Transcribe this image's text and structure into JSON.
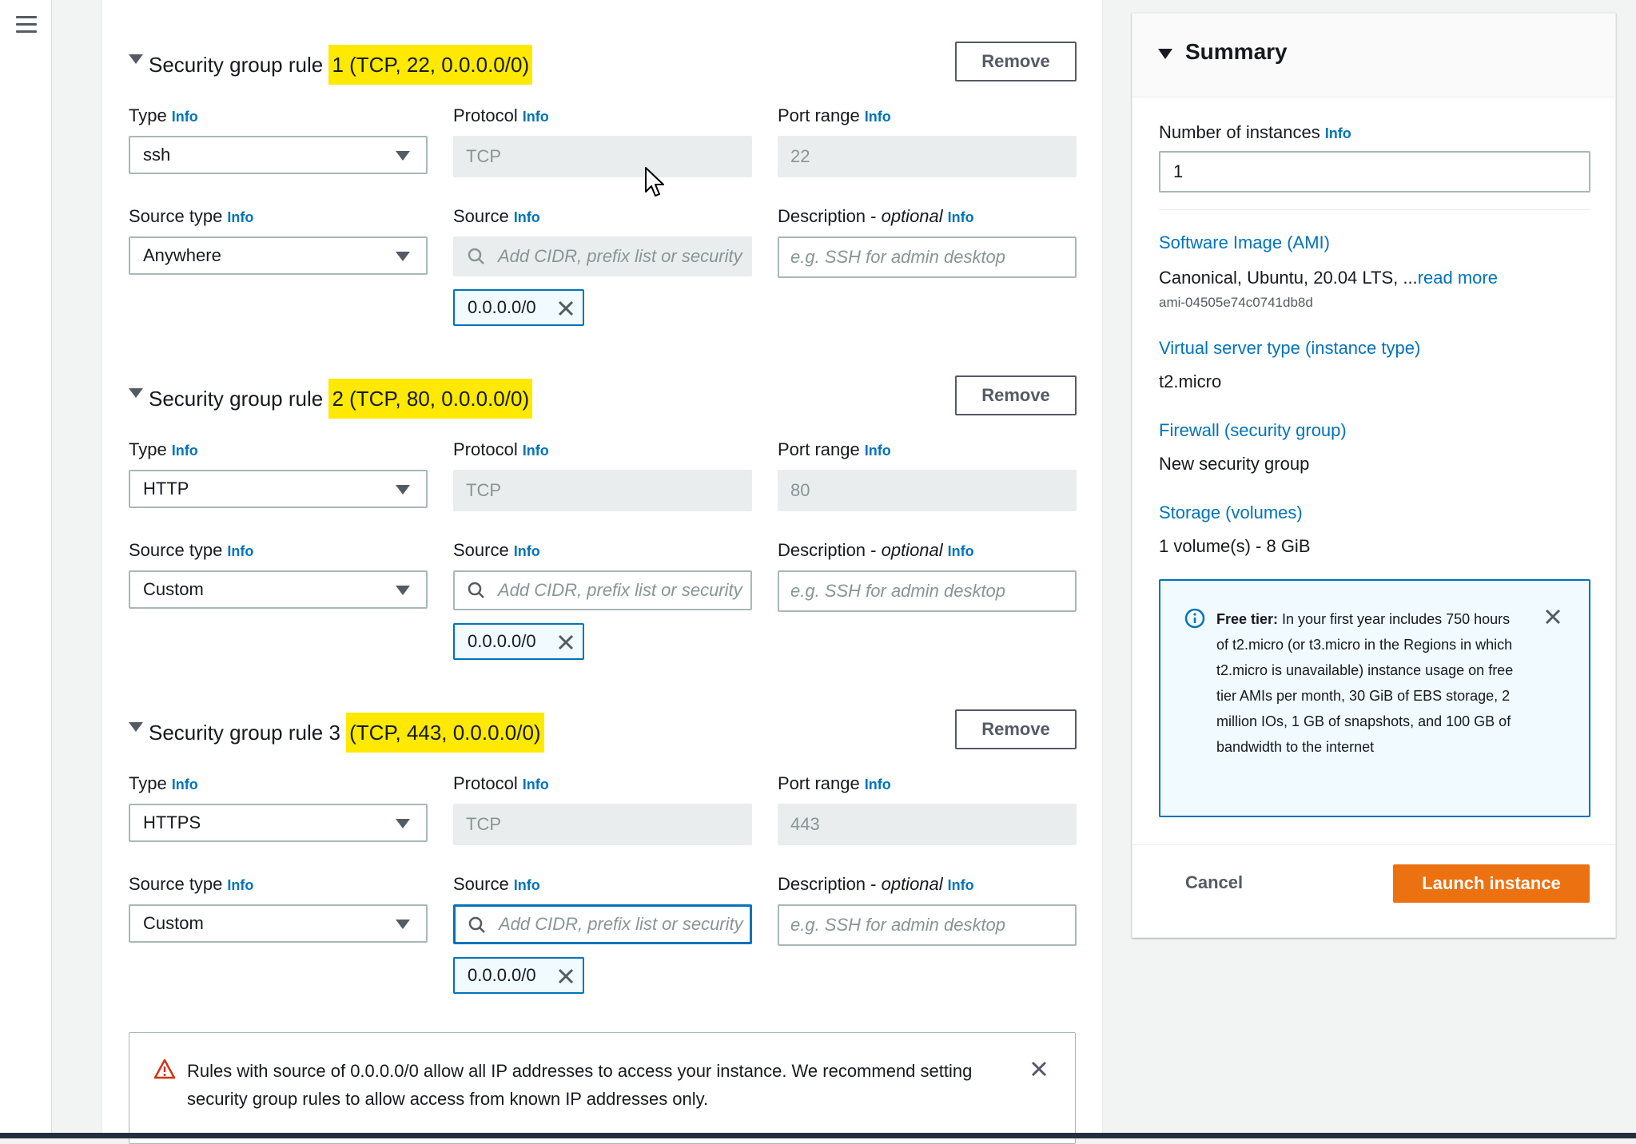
{
  "rules": [
    {
      "title_prefix": "Security group rule ",
      "title_highlight": "1 (TCP, 22, 0.0.0.0/0)",
      "remove_label": "Remove",
      "type_label": "Type",
      "type_value": "ssh",
      "protocol_label": "Protocol",
      "protocol_value": "TCP",
      "port_label": "Port range",
      "port_value": "22",
      "source_type_label": "Source type",
      "source_type_value": "Anywhere",
      "source_label": "Source",
      "source_placeholder": "Add CIDR, prefix list or security",
      "desc_label": "Description - ",
      "desc_optional": "optional",
      "desc_placeholder": "e.g. SSH for admin desktop",
      "token": "0.0.0.0/0"
    },
    {
      "title_prefix": "Security group rule ",
      "title_highlight": "2 (TCP, 80, 0.0.0.0/0)",
      "remove_label": "Remove",
      "type_label": "Type",
      "type_value": "HTTP",
      "protocol_label": "Protocol",
      "protocol_value": "TCP",
      "port_label": "Port range",
      "port_value": "80",
      "source_type_label": "Source type",
      "source_type_value": "Custom",
      "source_label": "Source",
      "source_placeholder": "Add CIDR, prefix list or security",
      "desc_label": "Description - ",
      "desc_optional": "optional",
      "desc_placeholder": "e.g. SSH for admin desktop",
      "token": "0.0.0.0/0"
    },
    {
      "title_prefix": "Security group rule 3 ",
      "title_highlight": "(TCP, 443, 0.0.0.0/0)",
      "remove_label": "Remove",
      "type_label": "Type",
      "type_value": "HTTPS",
      "protocol_label": "Protocol",
      "protocol_value": "TCP",
      "port_label": "Port range",
      "port_value": "443",
      "source_type_label": "Source type",
      "source_type_value": "Custom",
      "source_label": "Source",
      "source_placeholder": "Add CIDR, prefix list or security",
      "desc_label": "Description - ",
      "desc_optional": "optional",
      "desc_placeholder": "e.g. SSH for admin desktop",
      "token": "0.0.0.0/0"
    }
  ],
  "info_label": "Info",
  "warning": {
    "message": "Rules with source of 0.0.0.0/0 allow all IP addresses to access your instance. We recommend setting security group rules to allow access from known IP addresses only."
  },
  "summary": {
    "title": "Summary",
    "instances_label": "Number of instances",
    "instances_value": "1",
    "ami_label": "Software Image (AMI)",
    "ami_value": "Canonical, Ubuntu, 20.04 LTS, ...",
    "ami_read_more": "read more",
    "ami_id": "ami-04505e74c0741db8d",
    "instance_type_label": "Virtual server type (instance type)",
    "instance_type_value": "t2.micro",
    "firewall_label": "Firewall (security group)",
    "firewall_value": "New security group",
    "storage_label": "Storage (volumes)",
    "storage_value": "1 volume(s) - 8 GiB",
    "free_tier_title": "Free tier:",
    "free_tier_text": " In your first year includes 750 hours of t2.micro (or t3.micro in the Regions in which t2.micro is unavailable) instance usage on free tier AMIs per month, 30 GiB of EBS storage, 2 million IOs, 1 GB of snapshots, and 100 GB of bandwidth to the internet",
    "cancel_label": "Cancel",
    "launch_label": "Launch instance"
  },
  "colors": {
    "accent": "#0073bb",
    "highlight": "#ffe900",
    "launch": "#ec7211",
    "warning": "#d13212"
  },
  "icons": [
    "menu-icon",
    "caret-down-icon",
    "search-icon",
    "close-icon",
    "warning-icon",
    "info-icon",
    "mouse-cursor-icon"
  ]
}
